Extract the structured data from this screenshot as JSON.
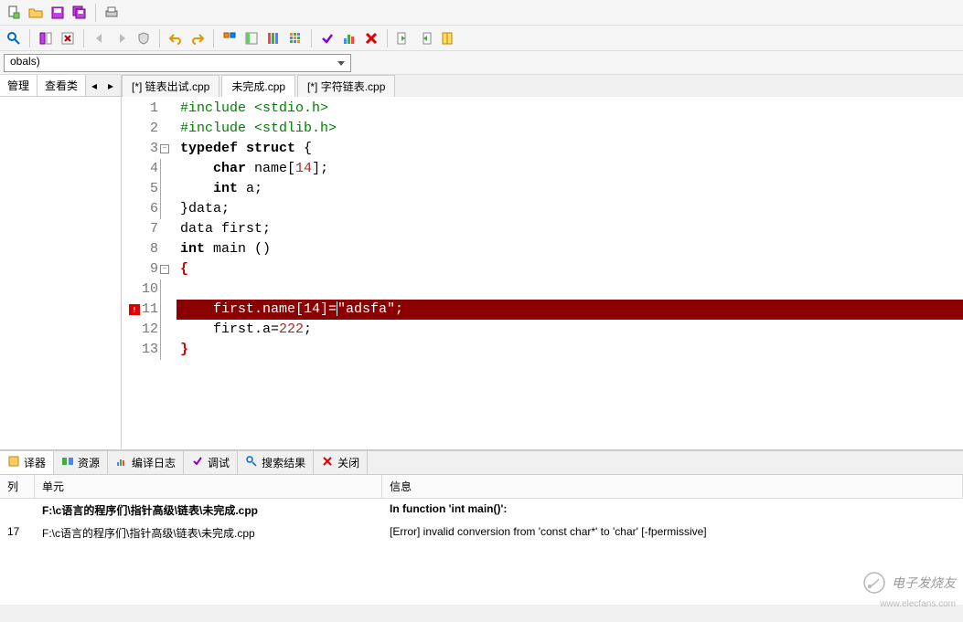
{
  "toolbar_icons": [
    "new",
    "open",
    "save",
    "save-all",
    "print",
    "search",
    "disk-view",
    "close-all",
    "back",
    "forward",
    "shield",
    "undo",
    "redo",
    "grid-2",
    "grid-border",
    "grid-3",
    "grid-9",
    "check",
    "chart",
    "delete",
    "exit-left",
    "exit-right",
    "book"
  ],
  "globals_combo": "obals)",
  "side_tabs": {
    "manage": "管理",
    "view_class": "查看类"
  },
  "file_tabs": [
    {
      "label": "[*] 链表出试.cpp",
      "active": false
    },
    {
      "label": "未完成.cpp",
      "active": true
    },
    {
      "label": "[*] 字符链表.cpp",
      "active": false
    }
  ],
  "code_lines": [
    {
      "n": "1",
      "html": "<span class='pp'>#include &lt;stdio.h&gt;</span>"
    },
    {
      "n": "2",
      "html": "<span class='pp'>#include &lt;stdlib.h&gt;</span>"
    },
    {
      "n": "3",
      "fold": true,
      "html": "<span class='kw'>typedef</span> <span class='kw'>struct</span> {"
    },
    {
      "n": "4",
      "bar": true,
      "html": "    <span class='kw'>char</span> name[<span class='num'>14</span>];"
    },
    {
      "n": "5",
      "bar": true,
      "html": "    <span class='kw'>int</span> a;"
    },
    {
      "n": "6",
      "bar": true,
      "html": "}data;"
    },
    {
      "n": "7",
      "html": "data first;"
    },
    {
      "n": "8",
      "html": "<span class='kw'>int</span> main ()"
    },
    {
      "n": "9",
      "fold": true,
      "html": "<span class='bracket-red'>{</span>"
    },
    {
      "n": "10",
      "bar": true,
      "html": ""
    },
    {
      "n": "11",
      "bar": true,
      "err": true,
      "hl": true,
      "html": "    first.name[14]=<span class='cursor-bar'></span>\"adsfa\";"
    },
    {
      "n": "12",
      "bar": true,
      "html": "    first.a=<span class='num'>222</span>;"
    },
    {
      "n": "13",
      "bar": true,
      "html": "<span class='bracket-red'>}</span>"
    }
  ],
  "bottom_tabs": [
    {
      "key": "compiler",
      "label": "译器"
    },
    {
      "key": "resource",
      "label": "资源"
    },
    {
      "key": "build_log",
      "label": "编译日志"
    },
    {
      "key": "debug",
      "label": "调试"
    },
    {
      "key": "search_results",
      "label": "搜索结果"
    },
    {
      "key": "close",
      "label": "关闭"
    }
  ],
  "msg_headers": {
    "line": "列",
    "unit": "单元",
    "info": "信息"
  },
  "msg_rows": [
    {
      "line": "",
      "unit": "F:\\c语言的程序们\\指针高级\\链表\\未完成.cpp",
      "info": "In function 'int main()':",
      "bold": true
    },
    {
      "line": "17",
      "unit": "F:\\c语言的程序们\\指针高级\\链表\\未完成.cpp",
      "info": "[Error] invalid conversion from 'const char*' to 'char' [-fpermissive]"
    }
  ],
  "watermark": {
    "text": "电子发烧友",
    "url": "www.elecfans.com"
  }
}
